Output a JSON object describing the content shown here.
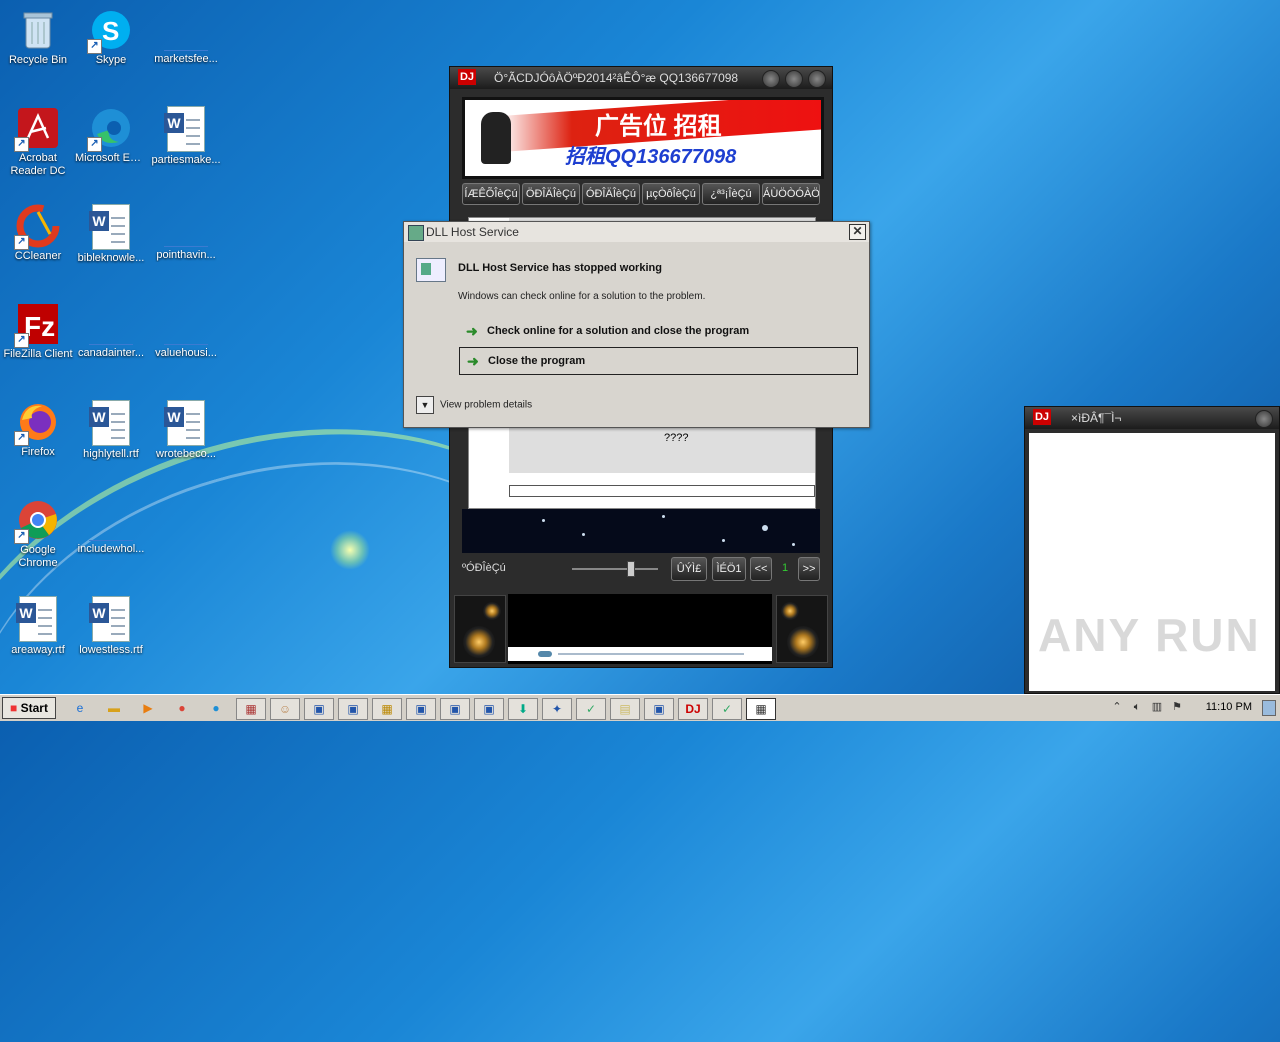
{
  "desktop": {
    "icons": [
      {
        "label": "Recycle Bin"
      },
      {
        "label": "Skype"
      },
      {
        "label": "marketsfee..."
      },
      {
        "label": "Acrobat Reader DC"
      },
      {
        "label": "Microsoft Edge"
      },
      {
        "label": "partiesmake..."
      },
      {
        "label": "CCleaner"
      },
      {
        "label": "bibleknowle..."
      },
      {
        "label": "pointhavin..."
      },
      {
        "label": "FileZilla Client"
      },
      {
        "label": "canadainter..."
      },
      {
        "label": "valuehousi..."
      },
      {
        "label": "Firefox"
      },
      {
        "label": "highlytell.rtf"
      },
      {
        "label": "wrotebeco..."
      },
      {
        "label": "Google Chrome"
      },
      {
        "label": "includewhol..."
      },
      {
        "label": "areaway.rtf"
      },
      {
        "label": "lowestless.rtf"
      }
    ]
  },
  "dj_player": {
    "title": "Ö°ÃCDJÓôÀÖºÐ2014²âÊÔ°æ QQ136677098",
    "logo": "DJ",
    "banner_big": "广告位 招租",
    "banner_qq": "招租QQ136677098",
    "tabs": [
      "ÍÆÊÕÎèÇú",
      "ÖÐÎÄÎèÇú",
      "ÓÐÎÄÎèÇú",
      "µçÒôÎèÇú",
      "¿ª³¡ÎèÇú",
      "ÁÙÖÒÓÀÖ"
    ],
    "inner_text": "????",
    "control_label": "ºÓÐÎèÇú",
    "buttons": [
      "ÛÝÌ£",
      "ÌÉÖ1",
      "<<",
      "1",
      ">>"
    ]
  },
  "dialog": {
    "title": "DLL Host Service",
    "heading": "DLL Host Service has stopped working",
    "subtext": "Windows can check online for a solution to the problem.",
    "option_check": "Check online for a solution and close the program",
    "option_close": "Close the program",
    "details": "View problem details"
  },
  "dj_side": {
    "logo": "DJ",
    "title": "×ìÐÂ¶¯Ì¬"
  },
  "watermark": "ANY RUN",
  "taskbar": {
    "start_label": "Start",
    "clock": "11:10 PM"
  }
}
